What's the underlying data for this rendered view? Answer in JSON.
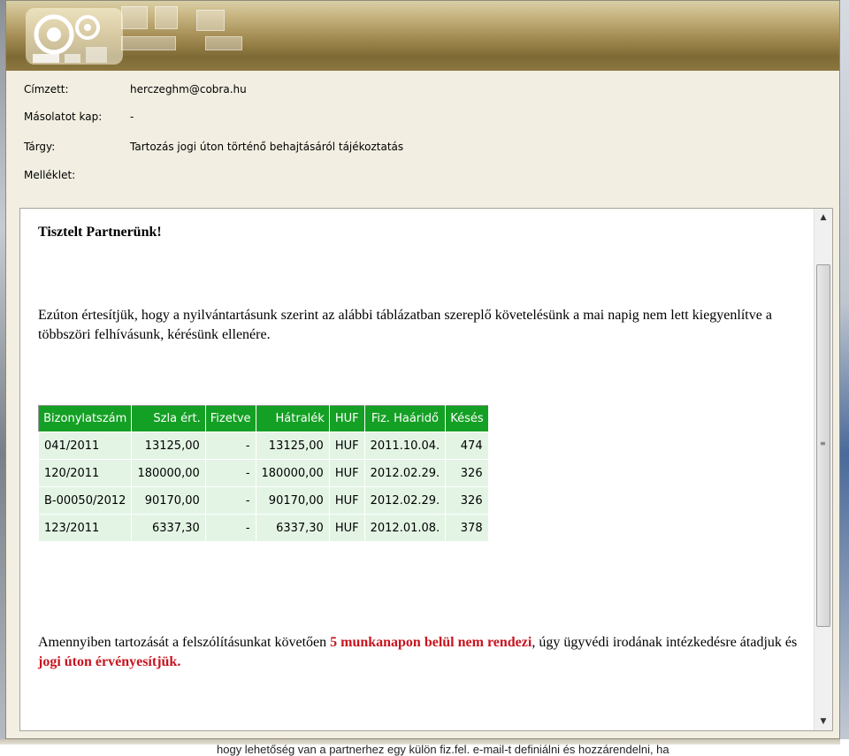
{
  "header": {
    "to_label": "Címzett:",
    "to_value": "herczeghm@cobra.hu",
    "cc_label": "Másolatot kap:",
    "cc_value": "-",
    "subject_label": "Tárgy:",
    "subject_value": "Tartozás jogi úton történő behajtásáról tájékoztatás",
    "attachment_label": "Melléklet:"
  },
  "body": {
    "greeting": "Tisztelt Partnerünk!",
    "para1": "Ezúton értesítjük, hogy a nyilvántartásunk szerint az alábbi táblázatban szereplő követelésünk a mai napig nem lett kiegyenlítve a többszöri felhívásunk, kérésünk ellenére.",
    "para2_a": "Amennyiben tartozását a felszólításunkat követően ",
    "para2_red1": "5 munkanapon belül nem rendezi",
    "para2_b": ", úgy ügyvédi irodának intézkedésre átadjuk és ",
    "para2_red2": "jogi úton érvényesítjük."
  },
  "table": {
    "headers": [
      "Bizonylatszám",
      "Szla ért.",
      "Fizetve",
      "Hátralék",
      "HUF",
      "Fiz. Haáridő",
      "Késés"
    ],
    "rows": [
      [
        "041/2011",
        "13125,00",
        "-",
        "13125,00",
        "HUF",
        "2011.10.04.",
        "474"
      ],
      [
        "120/2011",
        "180000,00",
        "-",
        "180000,00",
        "HUF",
        "2012.02.29.",
        "326"
      ],
      [
        "B-00050/2012",
        "90170,00",
        "-",
        "90170,00",
        "HUF",
        "2012.02.29.",
        "326"
      ],
      [
        "123/2011",
        "6337,30",
        "-",
        "6337,30",
        "HUF",
        "2012.01.08.",
        "378"
      ]
    ]
  },
  "scrollbar": {
    "up": "▲",
    "down": "▼",
    "grip": "≡"
  },
  "bottom_text": "hogy lehetőség van a partnerhez egy külön fiz.fel. e-mail-t definiálni és hozzárendelni, ha",
  "colors": {
    "table_header": "#14a024",
    "table_cell": "#e3f4e4",
    "highlight_red": "#c8141e"
  }
}
